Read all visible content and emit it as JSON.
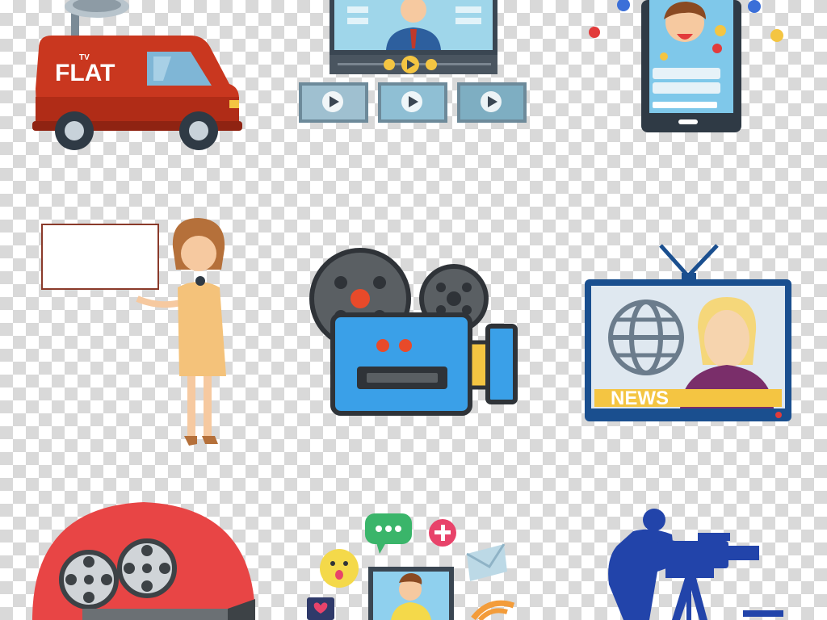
{
  "van": {
    "logo_text": "FLAT",
    "logo_sup": "TV"
  },
  "news_tv": {
    "banner_text": "NEWS"
  },
  "colors": {
    "van_red": "#c9371f",
    "camera_blue": "#3aa0e8",
    "news_blue": "#1a4f8f",
    "disc_red": "#e84545",
    "cameraman_blue": "#2244aa"
  }
}
